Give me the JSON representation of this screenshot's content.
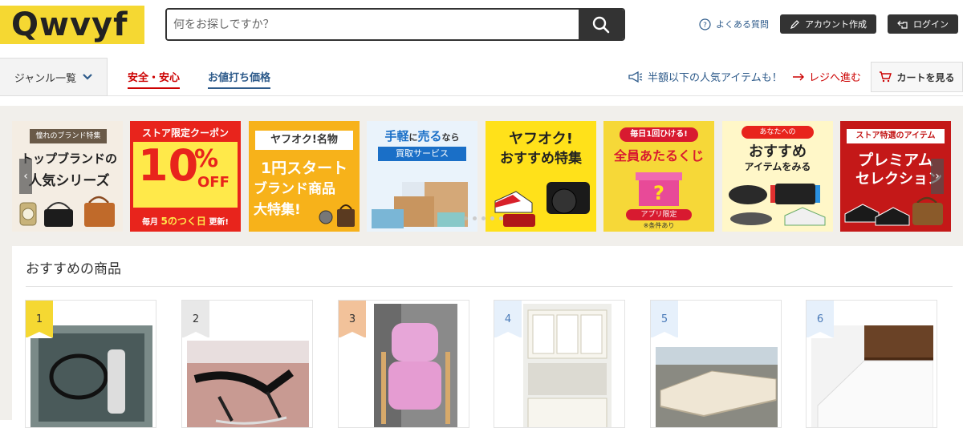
{
  "header": {
    "logo": "Qwvyf",
    "search_placeholder": "何をお探しですか？",
    "faq_label": "よくある質問",
    "signup_label": "アカウント作成",
    "login_label": "ログイン"
  },
  "nav": {
    "genre_label": "ジャンル一覧",
    "tab_safe": "安全・安心",
    "tab_price": "お値打ち価格",
    "promo_text": "半額以下の人気アイテムも！",
    "register_label": "レジへ進む",
    "cart_label": "カートを見る"
  },
  "banners": [
    {
      "top": "憧れのブランド特集",
      "line1": "トップブランドの",
      "line2": "人気シリーズ"
    },
    {
      "top": "ストア限定クーポン",
      "big": "10",
      "pct": "%",
      "off": "OFF",
      "foot1": "毎月",
      "foot2": "5のつく日",
      "foot3": "更新!"
    },
    {
      "top": "ヤフオク!名物",
      "line1": "1円スタート",
      "line2": "ブランド商品",
      "line3": "大特集!"
    },
    {
      "line1a": "手軽",
      "line1b": "に",
      "line1c": "売る",
      "line1d": "なら",
      "line2": "買取サービス"
    },
    {
      "line1": "ヤフオク!",
      "line2": "おすすめ特集"
    },
    {
      "top": "毎日1回ひける!",
      "line1": "全員あたるくじ",
      "badge": "アプリ限定",
      "note": "※条件あり"
    },
    {
      "top": "あなたへの",
      "line1": "おすすめ",
      "line2": "アイテムをみる"
    },
    {
      "top": "ストア特選のアイテム",
      "line1": "プレミアム",
      "line2": "セレクション"
    }
  ],
  "recommend": {
    "title": "おすすめの商品",
    "items": [
      {
        "rank": "1"
      },
      {
        "rank": "2"
      },
      {
        "rank": "3"
      },
      {
        "rank": "4"
      },
      {
        "rank": "5"
      },
      {
        "rank": "6"
      }
    ]
  },
  "colors": {
    "logo_yellow": "#f5d832",
    "accent_red": "#cc0000",
    "link_blue": "#2d5a8a",
    "rank1": "#f5d832",
    "rank2": "#e8e8e8",
    "rank3": "#f2c29a",
    "rank_other": "#e6f0fb"
  }
}
